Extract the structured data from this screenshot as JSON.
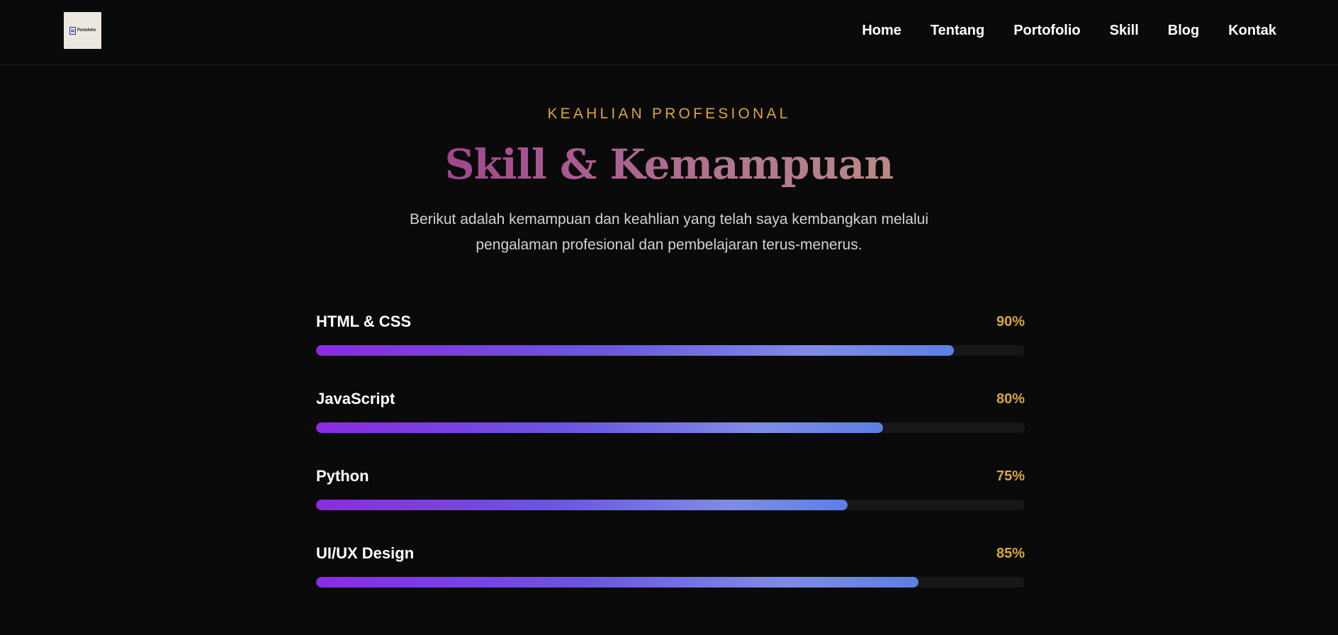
{
  "header": {
    "logo_text": "Portofolio",
    "nav": [
      {
        "label": "Home"
      },
      {
        "label": "Tentang"
      },
      {
        "label": "Portofolio"
      },
      {
        "label": "Skill"
      },
      {
        "label": "Blog"
      },
      {
        "label": "Kontak"
      }
    ]
  },
  "section": {
    "eyebrow": "KEAHLIAN PROFESIONAL",
    "title": "Skill & Kemampuan",
    "subtitle": "Berikut adalah kemampuan dan keahlian yang telah saya kembangkan melalui pengalaman profesional dan pembelajaran terus-menerus."
  },
  "skills": [
    {
      "name": "HTML & CSS",
      "percent_label": "90%",
      "level": 0.9
    },
    {
      "name": "JavaScript",
      "percent_label": "80%",
      "level": 0.8
    },
    {
      "name": "Python",
      "percent_label": "75%",
      "level": 0.75
    },
    {
      "name": "UI/UX Design",
      "percent_label": "85%",
      "level": 0.85
    }
  ],
  "colors": {
    "background": "#0a0a0a",
    "accent_gold": "#d9a63b",
    "bar_start": "#8a2be2",
    "bar_end": "#5b7fe3",
    "track": "#17171a"
  }
}
